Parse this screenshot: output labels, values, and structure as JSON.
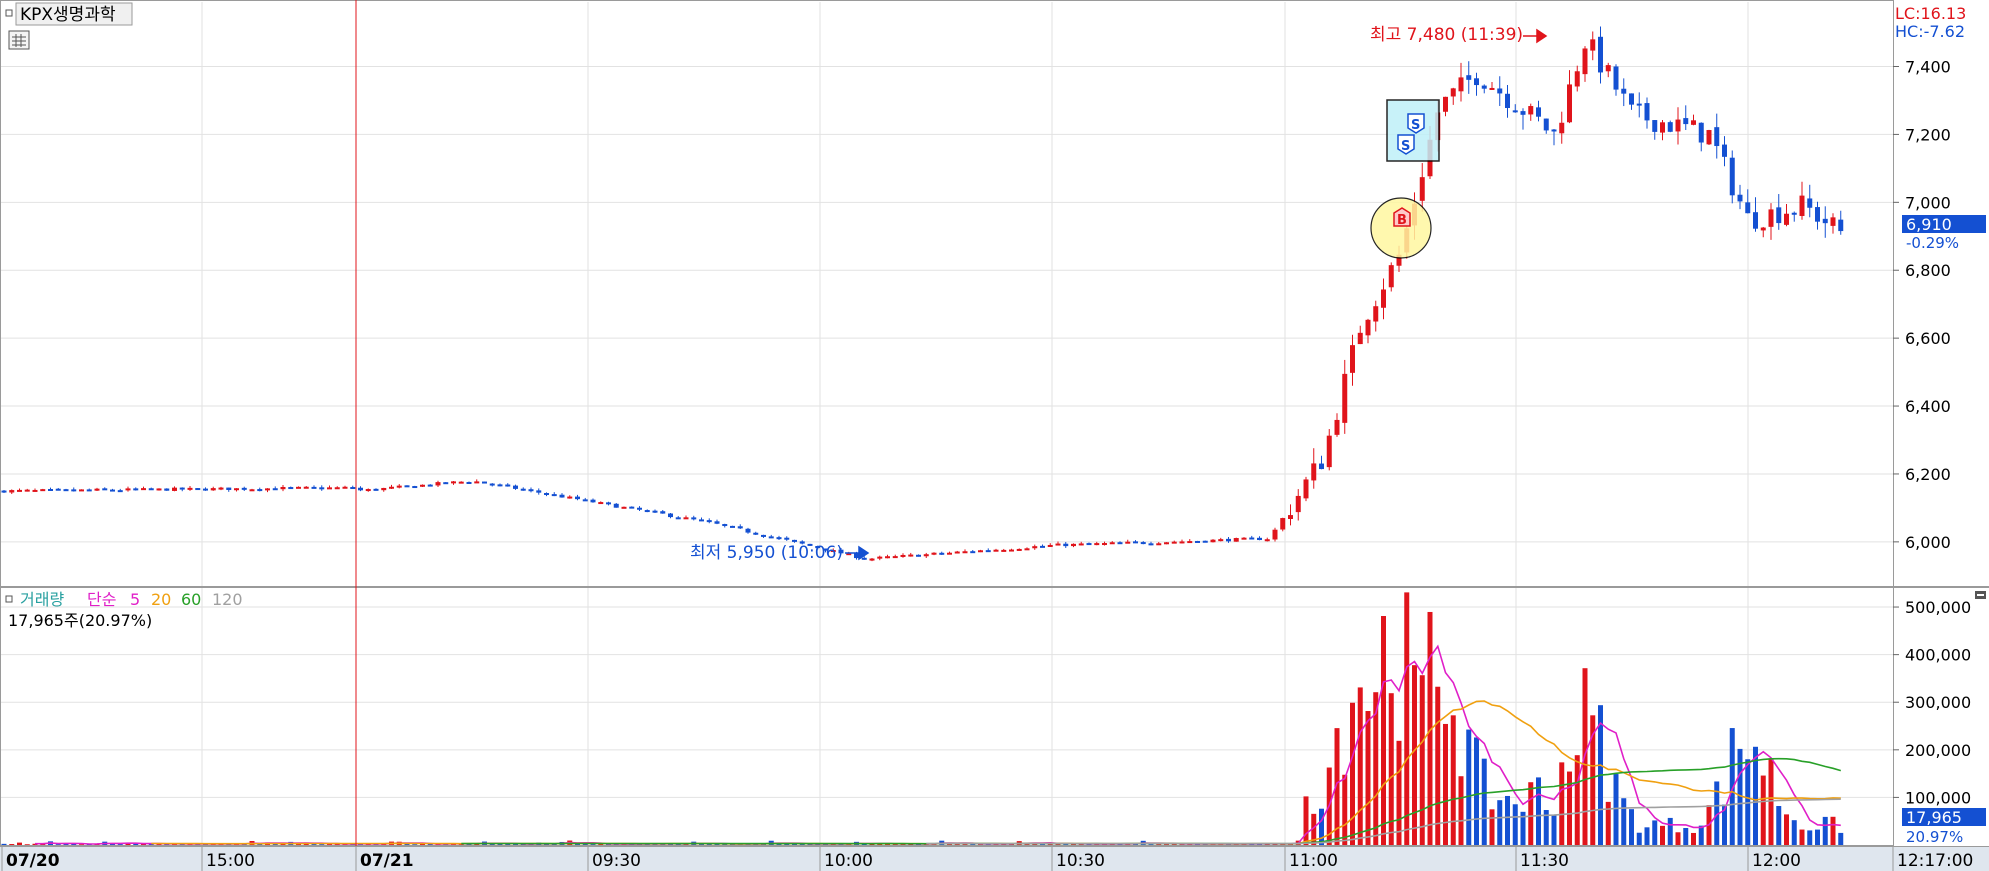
{
  "stock_name": "KPX생명과학",
  "indicators": {
    "lc": "LC:16.13",
    "hc": "HC:-7.62"
  },
  "price_badge": {
    "price": "6,910",
    "change": "-0.29%"
  },
  "high_label": "최고 7,480 (11:39)",
  "low_label": "최저 5,950 (10:06)",
  "trade_markers": [
    "S",
    "S",
    "B"
  ],
  "volume_legend": {
    "label": "거래량",
    "ma_type": "단순",
    "ma5": "5",
    "ma20": "20",
    "ma60": "60",
    "ma120": "120"
  },
  "volume_info": "17,965주(20.97%)",
  "volume_badge": {
    "volume": "17,965",
    "ratio": "20.97%"
  },
  "time_labels": [
    "07/20",
    "15:00",
    "07/21",
    "09:30",
    "10:00",
    "10:30",
    "11:00",
    "11:30",
    "12:00",
    "12:17:00"
  ],
  "colors": {
    "up": "#e0141b",
    "down": "#1450d2",
    "ma5": "#e020c8",
    "ma20": "#f0a010",
    "ma60": "#28a028",
    "ma120": "#a0a0a0",
    "accent": "#0040ff"
  },
  "chart_data": {
    "type": "candlestick",
    "price_axis": {
      "ticks": [
        "7,400",
        "7,200",
        "7,000",
        "6,800",
        "6,600",
        "6,400",
        "6,200",
        "6,000"
      ],
      "tick_values": [
        7400,
        7200,
        7000,
        6800,
        6600,
        6400,
        6200,
        6000
      ],
      "range": [
        5870,
        7590
      ]
    },
    "volume_axis": {
      "ticks": [
        "500,000",
        "400,000",
        "300,000",
        "200,000",
        "100,000"
      ],
      "tick_values": [
        500000,
        400000,
        300000,
        200000,
        100000
      ],
      "range": [
        0,
        540000
      ]
    },
    "price_series": [
      {
        "t": "07/20 14:20",
        "price": 6150
      },
      {
        "t": "07/20 15:20",
        "price": 6160
      },
      {
        "t": "07/21 09:00",
        "price": 6150
      },
      {
        "t": "07/21 09:15",
        "price": 6180
      },
      {
        "t": "07/21 09:45",
        "price": 6060
      },
      {
        "t": "07/21 10:06",
        "price": 5950
      },
      {
        "t": "07/21 10:30",
        "price": 5990
      },
      {
        "t": "07/21 10:58",
        "price": 6010
      },
      {
        "t": "07/21 11:05",
        "price": 6250
      },
      {
        "t": "07/21 11:10",
        "price": 6650
      },
      {
        "t": "07/21 11:15",
        "price": 6850
      },
      {
        "t": "07/21 11:20",
        "price": 7280
      },
      {
        "t": "07/21 11:25",
        "price": 7380
      },
      {
        "t": "07/21 11:35",
        "price": 7200
      },
      {
        "t": "07/21 11:39",
        "price": 7480
      },
      {
        "t": "07/21 11:45",
        "price": 7260
      },
      {
        "t": "07/21 11:55",
        "price": 7200
      },
      {
        "t": "07/21 12:00",
        "price": 6950
      },
      {
        "t": "07/21 12:10",
        "price": 6990
      },
      {
        "t": "07/21 12:17",
        "price": 6910
      }
    ],
    "high": {
      "value": 7480,
      "time": "11:39"
    },
    "low": {
      "value": 5950,
      "time": "10:06"
    },
    "current": {
      "price": 6910,
      "change_pct": -0.29,
      "volume": 17965,
      "volume_pct": 20.97
    },
    "volume_peaks": [
      {
        "t": "11:10",
        "volume": 390000
      },
      {
        "t": "11:14",
        "volume": 500000
      },
      {
        "t": "11:20",
        "volume": 410000
      },
      {
        "t": "11:39",
        "volume": 330000
      },
      {
        "t": "12:00",
        "volume": 270000
      }
    ]
  }
}
